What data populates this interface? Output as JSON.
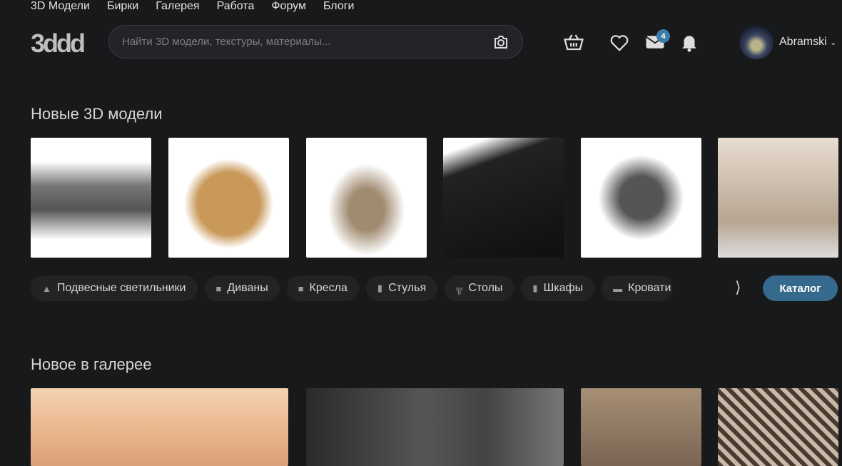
{
  "nav": [
    "3D Модели",
    "Бирки",
    "Галерея",
    "Работа",
    "Форум",
    "Блоги"
  ],
  "logo": "3ddd",
  "search": {
    "placeholder": "Найти 3D модели, текстуры, материалы..."
  },
  "header": {
    "messages_count": "4",
    "username": "Abramski"
  },
  "sections": {
    "new_models": "Новые 3D модели",
    "gallery": "Новое в галерее"
  },
  "categories": [
    "Подвесные светильники",
    "Диваны",
    "Кресла",
    "Стулья",
    "Столы",
    "Шкафы",
    "Кровати"
  ],
  "catalog_label": "Каталог"
}
